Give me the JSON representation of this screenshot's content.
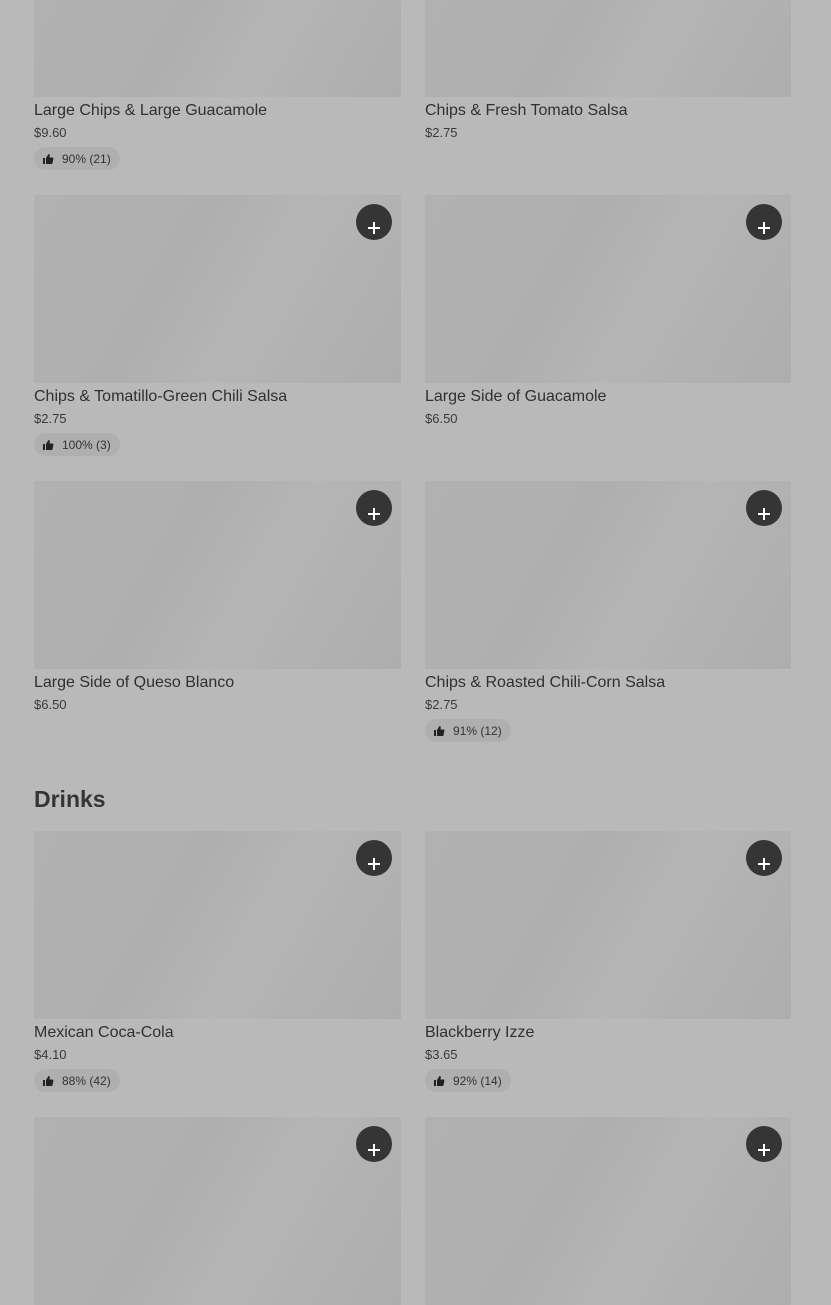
{
  "sections": {
    "drinks_title": "Drinks"
  },
  "items": [
    {
      "name": "Large Chips & Large Guacamole",
      "price": "$9.60",
      "rating": "90% (21)"
    },
    {
      "name": "Chips & Fresh Tomato Salsa",
      "price": "$2.75",
      "rating": null
    },
    {
      "name": "Chips & Tomatillo-Green Chili Salsa",
      "price": "$2.75",
      "rating": "100% (3)"
    },
    {
      "name": "Large Side of Guacamole",
      "price": "$6.50",
      "rating": null
    },
    {
      "name": "Large Side of Queso Blanco",
      "price": "$6.50",
      "rating": null
    },
    {
      "name": "Chips & Roasted Chili-Corn Salsa",
      "price": "$2.75",
      "rating": "91% (12)"
    },
    {
      "name": "Mexican Coca-Cola",
      "price": "$4.10",
      "rating": "88% (42)"
    },
    {
      "name": "Blackberry Izze",
      "price": "$3.65",
      "rating": "92% (14)"
    }
  ],
  "icons": {
    "add": "plus-icon",
    "rating": "thumbs-up-icon"
  },
  "colors": {
    "page_background": "#b9b9b9",
    "add_button": "#353535",
    "rating_pill": "#afafaf"
  }
}
